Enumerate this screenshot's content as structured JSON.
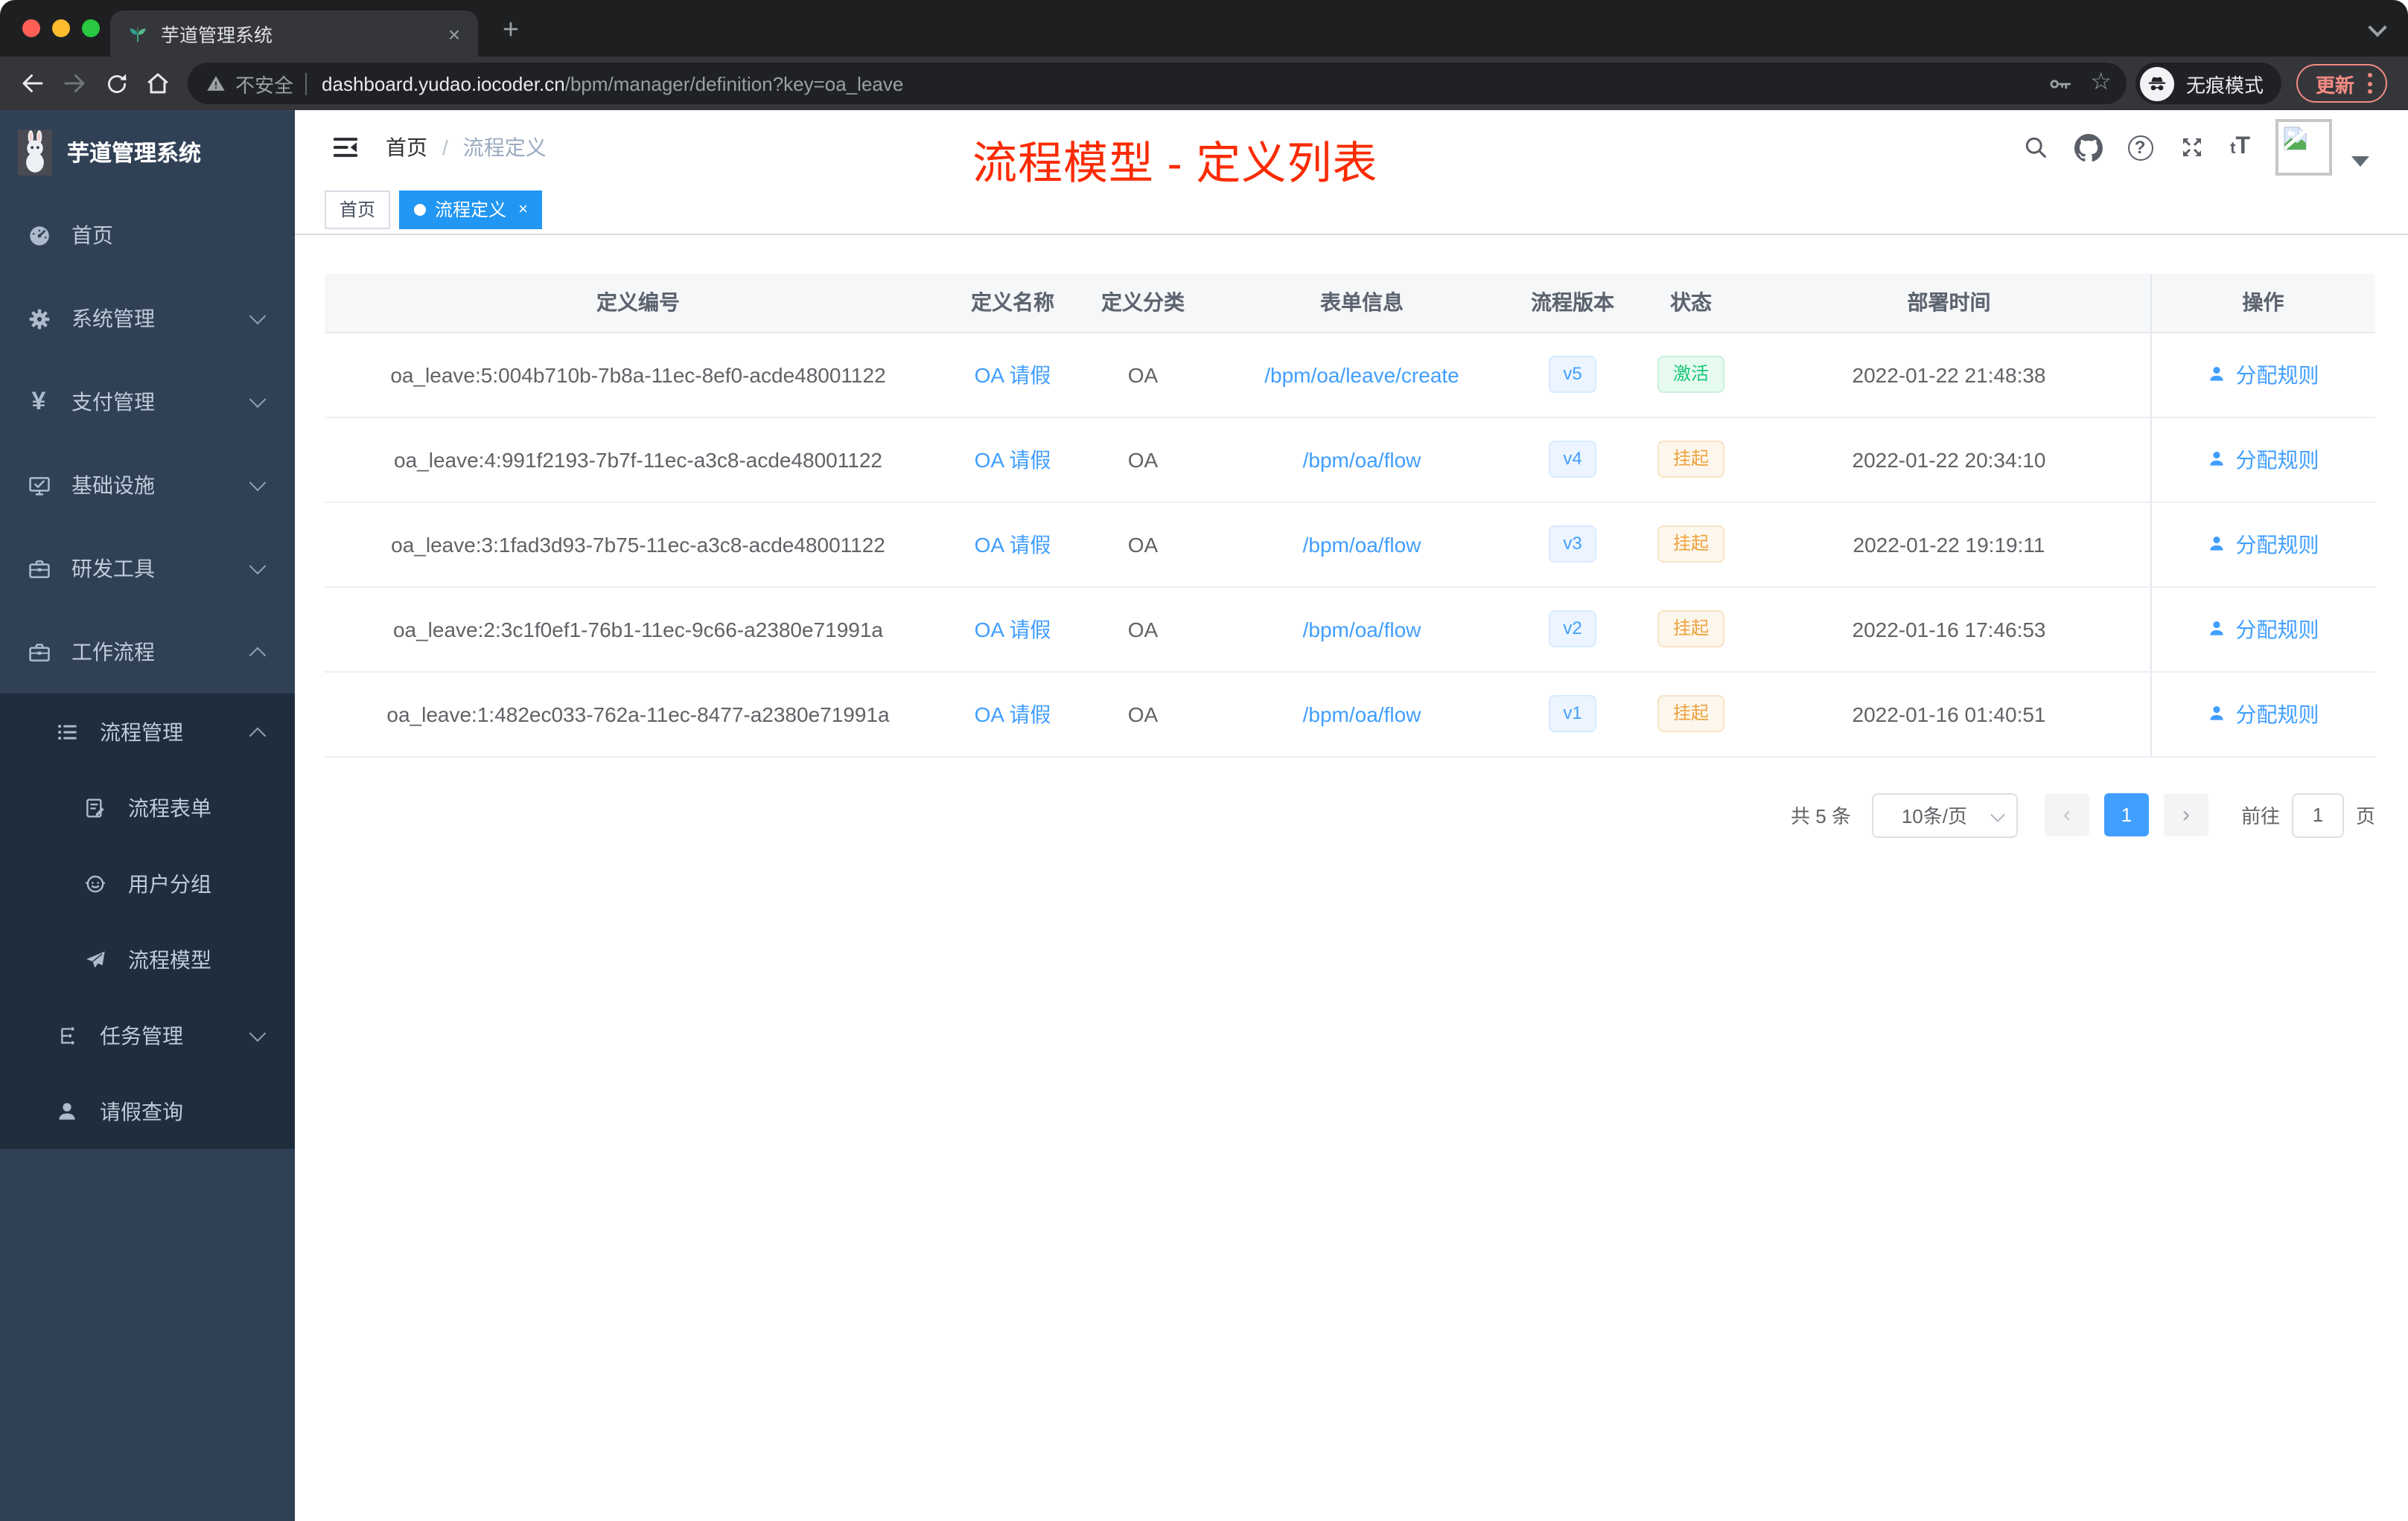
{
  "browser": {
    "tab_title": "芋道管理系统",
    "tab_close": "×",
    "new_tab": "+",
    "security_label": "不安全",
    "url_host": "dashboard.yudao.iocoder.cn",
    "url_path": "/bpm/manager/definition?key=oa_leave",
    "incognito_label": "无痕模式",
    "update_label": "更新"
  },
  "sidebar": {
    "logo_title": "芋道管理系统",
    "items": [
      {
        "label": "首页"
      },
      {
        "label": "系统管理"
      },
      {
        "label": "支付管理"
      },
      {
        "label": "基础设施"
      },
      {
        "label": "研发工具"
      },
      {
        "label": "工作流程"
      },
      {
        "label": "流程管理"
      },
      {
        "label": "流程表单"
      },
      {
        "label": "用户分组"
      },
      {
        "label": "流程模型"
      },
      {
        "label": "任务管理"
      },
      {
        "label": "请假查询"
      }
    ]
  },
  "navbar": {
    "breadcrumb_home": "首页",
    "breadcrumb_sep": "/",
    "breadcrumb_current": "流程定义",
    "annotation": "流程模型 - 定义列表",
    "text_size_icon": "tT"
  },
  "tags": {
    "first": "首页",
    "active": "流程定义",
    "close": "×"
  },
  "table": {
    "headers": [
      "定义编号",
      "定义名称",
      "定义分类",
      "表单信息",
      "流程版本",
      "状态",
      "部署时间",
      "操作"
    ],
    "rows": [
      {
        "id": "oa_leave:5:004b710b-7b8a-11ec-8ef0-acde48001122",
        "name": "OA 请假",
        "category": "OA",
        "form": "/bpm/oa/leave/create",
        "version": "v5",
        "status": "激活",
        "time": "2022-01-22 21:48:38",
        "action": "分配规则"
      },
      {
        "id": "oa_leave:4:991f2193-7b7f-11ec-a3c8-acde48001122",
        "name": "OA 请假",
        "category": "OA",
        "form": "/bpm/oa/flow",
        "version": "v4",
        "status": "挂起",
        "time": "2022-01-22 20:34:10",
        "action": "分配规则"
      },
      {
        "id": "oa_leave:3:1fad3d93-7b75-11ec-a3c8-acde48001122",
        "name": "OA 请假",
        "category": "OA",
        "form": "/bpm/oa/flow",
        "version": "v3",
        "status": "挂起",
        "time": "2022-01-22 19:19:11",
        "action": "分配规则"
      },
      {
        "id": "oa_leave:2:3c1f0ef1-76b1-11ec-9c66-a2380e71991a",
        "name": "OA 请假",
        "category": "OA",
        "form": "/bpm/oa/flow",
        "version": "v2",
        "status": "挂起",
        "time": "2022-01-16 17:46:53",
        "action": "分配规则"
      },
      {
        "id": "oa_leave:1:482ec033-762a-11ec-8477-a2380e71991a",
        "name": "OA 请假",
        "category": "OA",
        "form": "/bpm/oa/flow",
        "version": "v1",
        "status": "挂起",
        "time": "2022-01-16 01:40:51",
        "action": "分配规则"
      }
    ]
  },
  "pagination": {
    "total": "共 5 条",
    "page_size": "10条/页",
    "prev": "‹",
    "page": "1",
    "next": "›",
    "goto_label": "前往",
    "goto_value": "1",
    "unit": "页"
  },
  "colors": {
    "accent_blue": "#409eff",
    "active_tab_blue": "#2196f3",
    "success_green": "#15c877",
    "warning_orange": "#eda23d",
    "annotation_red": "#fb2b01",
    "sidebar_bg": "#304156",
    "submenu_bg": "#1f2d3d"
  }
}
